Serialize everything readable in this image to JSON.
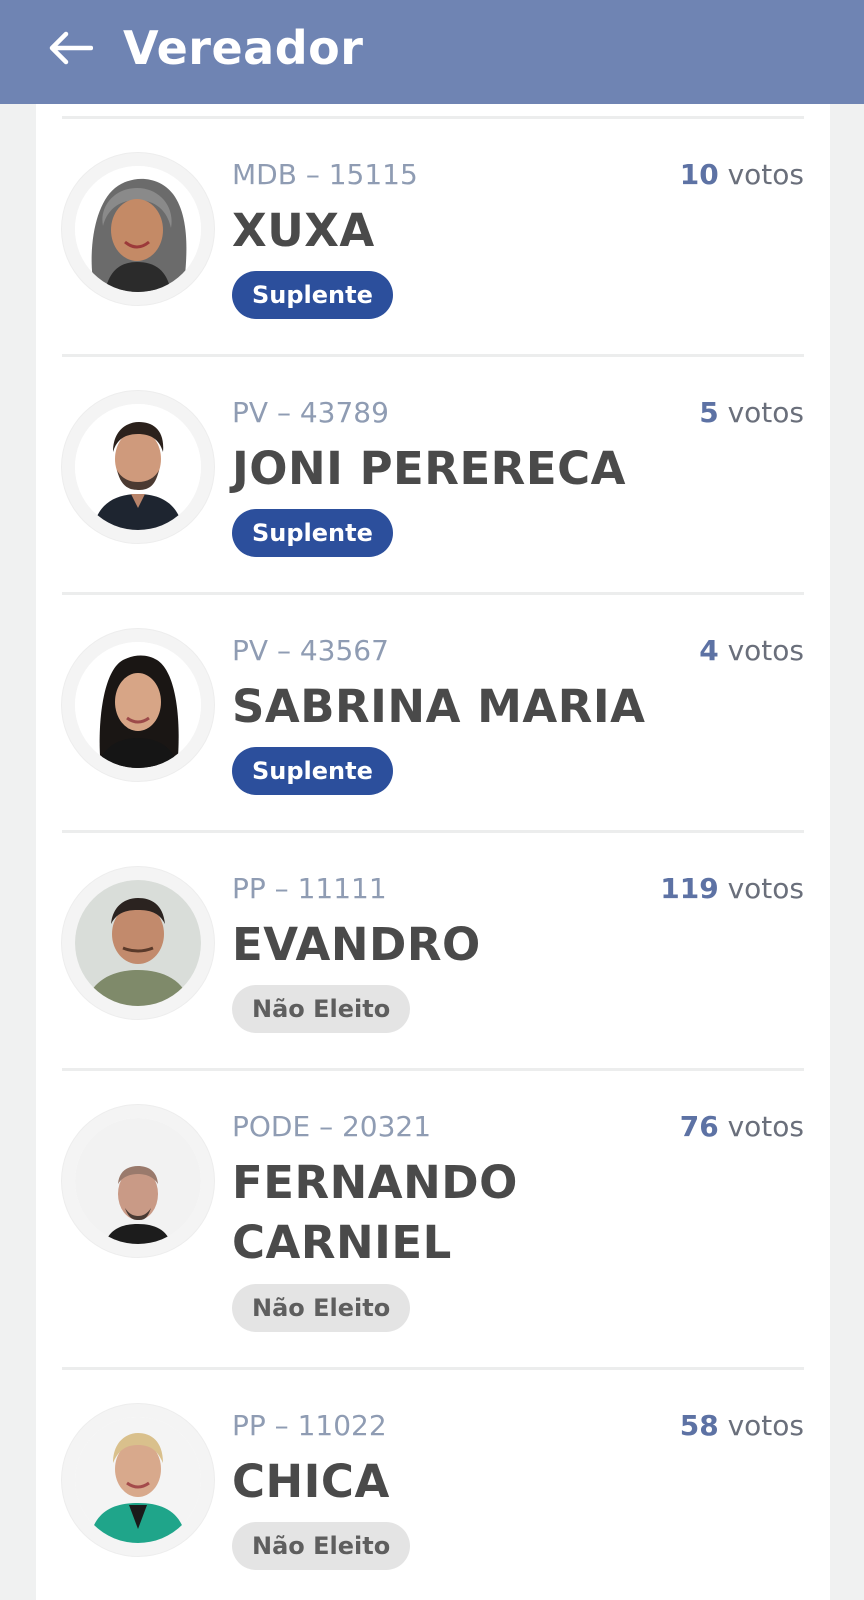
{
  "header": {
    "title": "Vereador",
    "back_icon": "arrow-left-icon",
    "background": "#6f84b3"
  },
  "candidates": [
    {
      "party_number": "MDB – 15115",
      "name": "XUXA",
      "votes": "10",
      "votes_label": "votos",
      "status": "Suplente",
      "status_type": "suplente"
    },
    {
      "party_number": "PV – 43789",
      "name": "JONI PERERECA",
      "votes": "5",
      "votes_label": "votos",
      "status": "Suplente",
      "status_type": "suplente"
    },
    {
      "party_number": "PV – 43567",
      "name": "SABRINA MARIA",
      "votes": "4",
      "votes_label": "votos",
      "status": "Suplente",
      "status_type": "suplente"
    },
    {
      "party_number": "PP – 11111",
      "name": "EVANDRO",
      "votes": "119",
      "votes_label": "votos",
      "status": "Não Eleito",
      "status_type": "naoeleito"
    },
    {
      "party_number": "PODE – 20321",
      "name": "FERNANDO CARNIEL",
      "votes": "76",
      "votes_label": "votos",
      "status": "Não Eleito",
      "status_type": "naoeleito"
    },
    {
      "party_number": "PP – 11022",
      "name": "CHICA",
      "votes": "58",
      "votes_label": "votos",
      "status": "Não Eleito",
      "status_type": "naoeleito"
    }
  ],
  "colors": {
    "suplente_badge": "#2c4f9c",
    "nao_eleito_badge": "#e4e4e4",
    "vote_number": "#5d72a4"
  }
}
